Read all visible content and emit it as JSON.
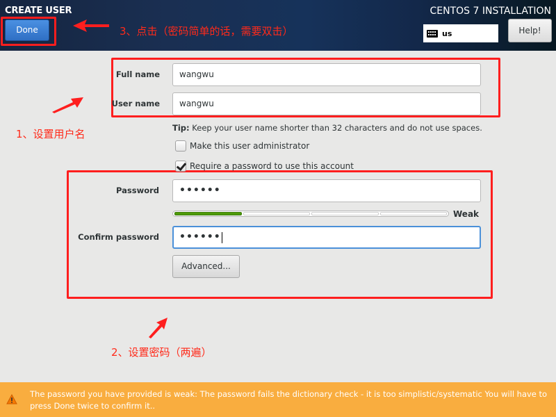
{
  "header": {
    "title": "CREATE USER",
    "done_label": "Done",
    "install_title": "CENTOS 7 INSTALLATION",
    "keyboard_layout": "us",
    "help_label": "Help!"
  },
  "form": {
    "full_name_label": "Full name",
    "full_name_value": "wangwu",
    "user_name_label": "User name",
    "user_name_value": "wangwu",
    "tip_prefix": "Tip:",
    "tip_text": "Keep your user name shorter than 32 characters and do not use spaces.",
    "admin_checkbox_label": "Make this user administrator",
    "admin_checked": false,
    "require_password_label": "Require a password to use this account",
    "require_password_checked": true,
    "password_label": "Password",
    "password_value": "••••••",
    "strength_fraction": 0.25,
    "strength_label": "Weak",
    "confirm_password_label": "Confirm password",
    "confirm_password_value": "••••••",
    "advanced_label": "Advanced..."
  },
  "annotations": {
    "step1": "1、设置用户名",
    "step2": "2、设置密码（两遍）",
    "step3": "3、点击（密码简单的话，需要双击）",
    "color": "#ff1e1e"
  },
  "warning": {
    "text": "The password you have provided is weak: The password fails the dictionary check - it is too simplistic/systematic You will have to press Done twice to confirm it..",
    "color": "#f9ad3f"
  }
}
